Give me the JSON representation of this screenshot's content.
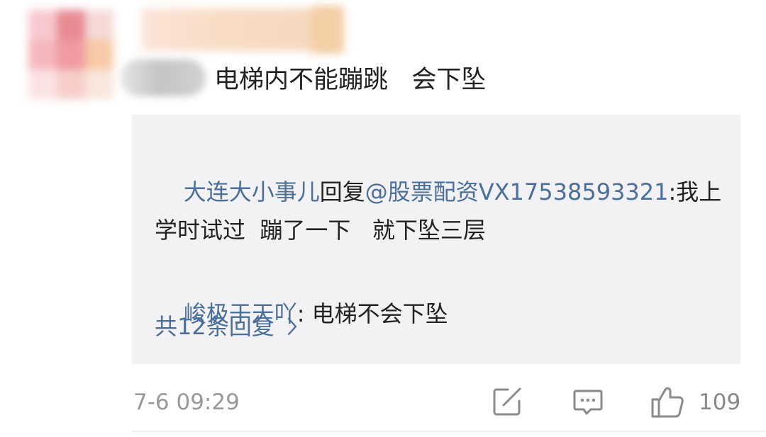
{
  "comment": {
    "text": "电梯内不能蹦跳   会下坠",
    "replies": [
      {
        "user": "大连大小事儿",
        "connector": "回复",
        "target": "@股票配资VX17538593321",
        "text": ":我上学时试过  蹦了一下   就下坠三层"
      },
      {
        "user": "峻极于天吖",
        "text": ": 电梯不会下坠"
      }
    ],
    "more_replies_label": "共12条回复",
    "timestamp": "7-6 09:29",
    "like_count": "109"
  },
  "colors": {
    "link": "#4a6f98",
    "text": "#222222",
    "meta": "#999999",
    "reply_bg": "#f2f2f4"
  },
  "icons": [
    "edit-icon",
    "comment-icon",
    "thumbs-up-icon",
    "chevron-right-icon"
  ]
}
